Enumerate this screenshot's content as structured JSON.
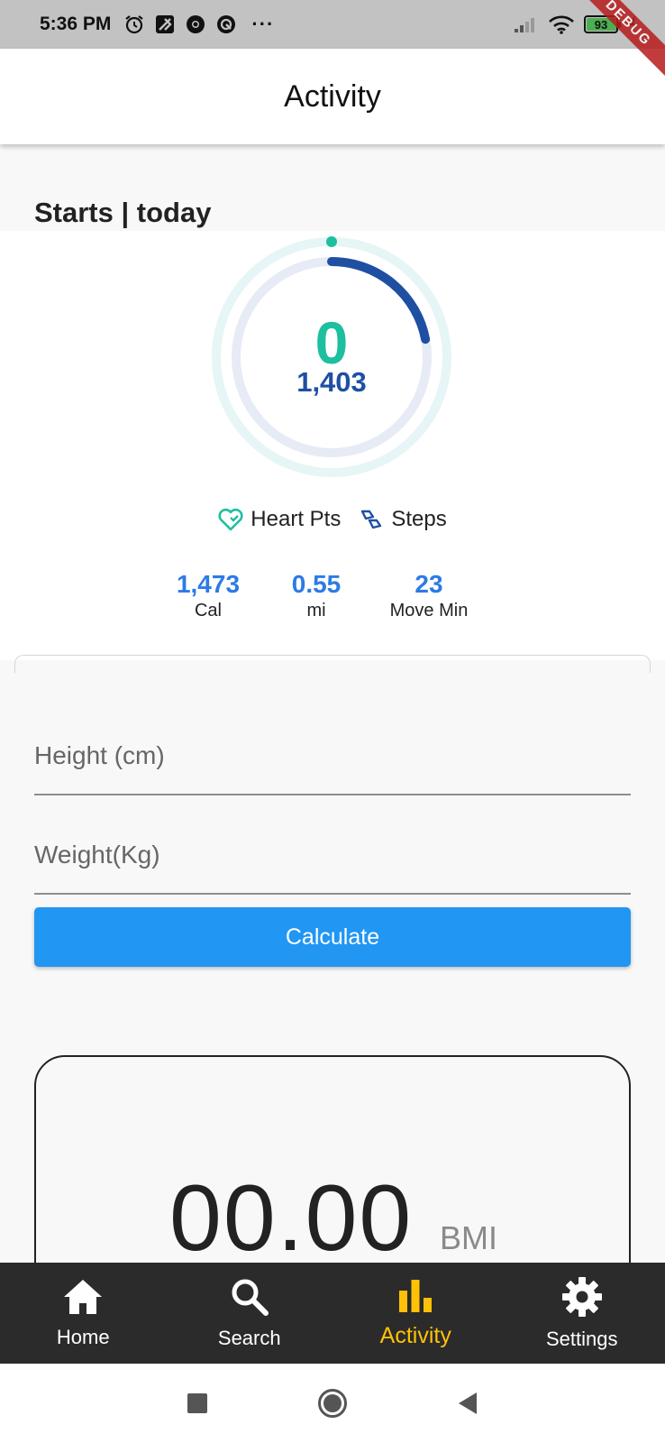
{
  "status_bar": {
    "time": "5:36 PM",
    "overflow": "···",
    "battery_level": "93",
    "icons": [
      "alarm-icon",
      "maps-icon",
      "chrome-icon",
      "sync-icon",
      "signal-icon",
      "wifi-icon",
      "battery-icon",
      "charging-icon"
    ]
  },
  "debug_banner": "DEBUG",
  "app_bar": {
    "title": "Activity"
  },
  "section": {
    "heading": "Starts | today"
  },
  "fit_card": {
    "heart_points": "0",
    "steps": "1,403",
    "steps_goal_fraction": 0.22,
    "legend": {
      "heart_label": "Heart Pts",
      "steps_label": "Steps"
    },
    "stats": [
      {
        "value": "1,473",
        "label": "Cal"
      },
      {
        "value": "0.55",
        "label": "mi"
      },
      {
        "value": "23",
        "label": "Move Min"
      }
    ],
    "colors": {
      "heart": "#1dbf9f",
      "steps": "#1e4fa3",
      "stat": "#2c7be5"
    }
  },
  "form": {
    "height_placeholder": "Height (cm)",
    "weight_placeholder": "Weight(Kg)",
    "calculate_label": "Calculate"
  },
  "bmi": {
    "value": "00.00",
    "unit": "BMI"
  },
  "bottom_nav": {
    "items": [
      {
        "label": "Home",
        "icon": "home-icon"
      },
      {
        "label": "Search",
        "icon": "search-icon"
      },
      {
        "label": "Activity",
        "icon": "bar-chart-icon",
        "active": true
      },
      {
        "label": "Settings",
        "icon": "gear-icon"
      }
    ],
    "active_color": "#ffc107"
  },
  "system_nav": {
    "buttons": [
      "recents-button",
      "home-button",
      "back-button"
    ]
  }
}
